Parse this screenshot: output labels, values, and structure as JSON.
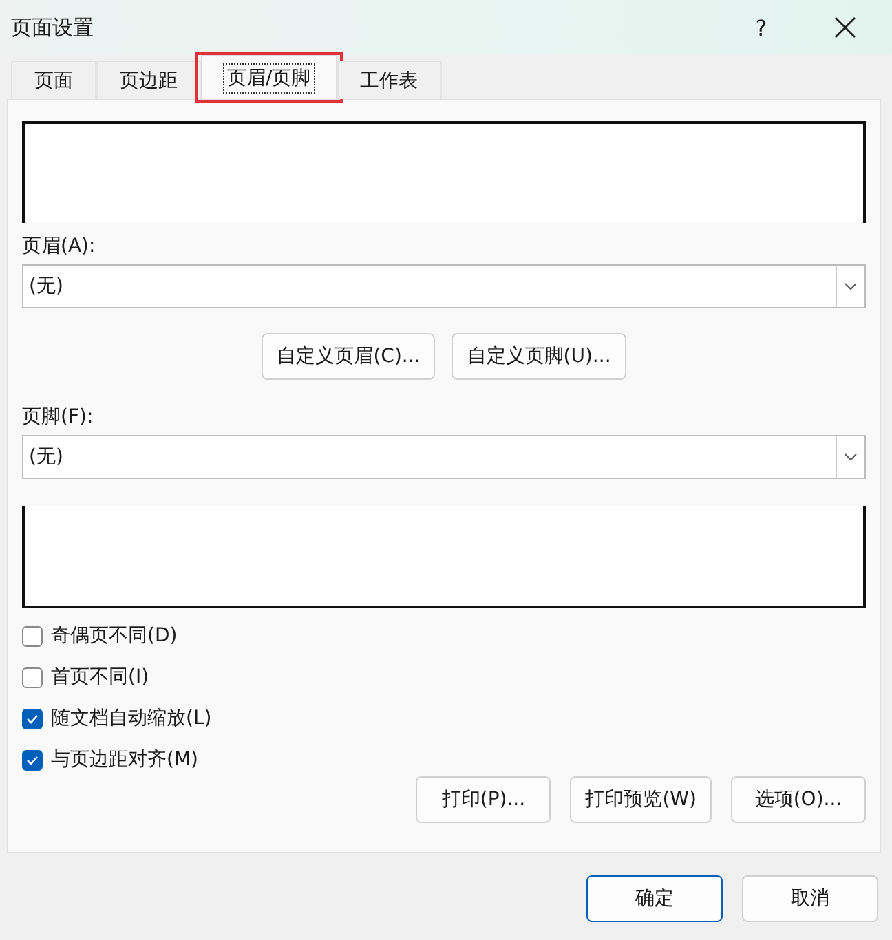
{
  "window": {
    "title": "页面设置",
    "help": "?"
  },
  "tabs": [
    {
      "label": "页面",
      "selected": false,
      "highlighted": false
    },
    {
      "label": "页边距",
      "selected": false,
      "highlighted": false
    },
    {
      "label": "页眉/页脚",
      "selected": true,
      "highlighted": true
    },
    {
      "label": "工作表",
      "selected": false,
      "highlighted": false
    }
  ],
  "header": {
    "label": "页眉(A):",
    "value": "(无)"
  },
  "custom_buttons": [
    "自定义页眉(C)...",
    "自定义页脚(U)..."
  ],
  "footer": {
    "label": "页脚(F):",
    "value": "(无)"
  },
  "options": [
    {
      "label": "奇偶页不同(D)",
      "checked": false
    },
    {
      "label": "首页不同(I)",
      "checked": false
    },
    {
      "label": "随文档自动缩放(L)",
      "checked": true
    },
    {
      "label": "与页边距对齐(M)",
      "checked": true
    }
  ],
  "panel_buttons": [
    "打印(P)...",
    "打印预览(W)",
    "选项(O)..."
  ],
  "dialog_buttons": [
    {
      "label": "确定",
      "default": true
    },
    {
      "label": "取消",
      "default": false
    }
  ]
}
